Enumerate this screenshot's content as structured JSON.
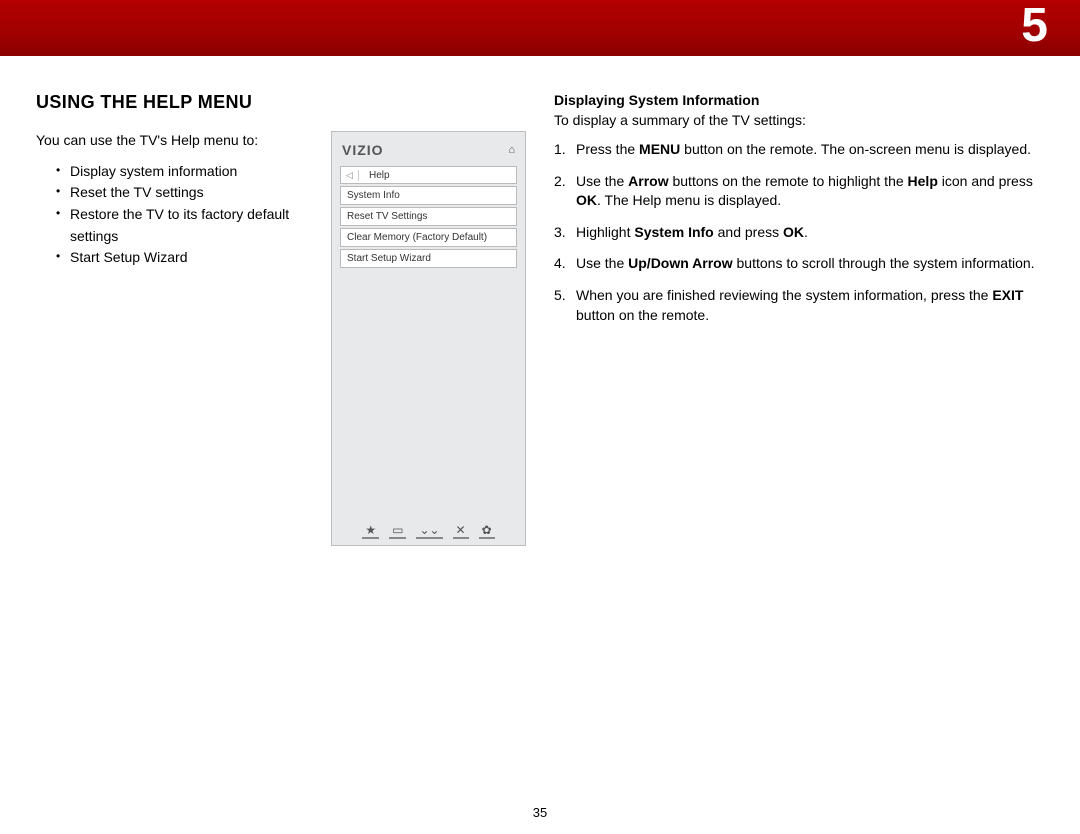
{
  "chapter_number": "5",
  "page_number": "35",
  "left": {
    "title": "Using the Help Menu",
    "intro": "You can use the TV's Help menu to:",
    "bullets": [
      "Display system information",
      "Reset the TV settings",
      "Restore the TV to its factory default settings",
      "Start Setup Wizard"
    ]
  },
  "tv_menu": {
    "logo": "VIZIO",
    "home_icon": "⌂",
    "back_icon": "◁",
    "breadcrumb": "Help",
    "items": [
      "System Info",
      "Reset TV Settings",
      "Clear Memory (Factory Default)",
      "Start Setup Wizard"
    ],
    "footer_icons": [
      "★",
      "▭",
      "⌄⌄",
      "✕",
      "✿"
    ]
  },
  "right": {
    "subhead": "Displaying System Information",
    "lead": "To display a summary of the TV settings:",
    "steps": [
      {
        "pre": "Press the ",
        "b1": "MENU",
        "mid": " button on the remote. The on-screen menu is displayed.",
        "b2": "",
        "post": ""
      },
      {
        "pre": "Use the ",
        "b1": "Arrow",
        "mid": " buttons on the remote to highlight the ",
        "b2": "Help",
        "post": " icon and press ",
        "b3": "OK",
        "tail": ". The Help menu is displayed."
      },
      {
        "pre": "Highlight ",
        "b1": "System Info",
        "mid": " and press ",
        "b2": "OK",
        "post": "."
      },
      {
        "pre": "Use the ",
        "b1": "Up/Down Arrow",
        "mid": " buttons to scroll through the system information.",
        "b2": "",
        "post": ""
      },
      {
        "pre": "When you are finished reviewing the system information, press the ",
        "b1": "EXIT",
        "mid": " button on the remote.",
        "b2": "",
        "post": ""
      }
    ]
  }
}
